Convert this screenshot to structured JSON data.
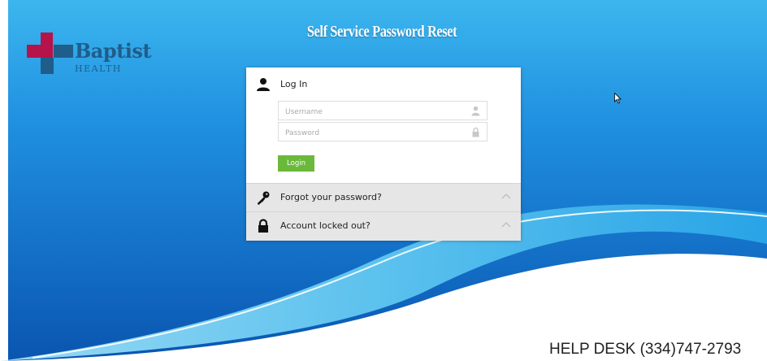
{
  "brand": {
    "name": "Baptist",
    "subname": "HEALTH",
    "logo_colors": {
      "red": "#b5134a",
      "blue": "#1f5d8a"
    }
  },
  "page": {
    "title": "Self Service Password Reset",
    "background_colors": {
      "top": "#1fa3e0",
      "bottom": "#0b5fb8",
      "swoosh": "#7fd3f5"
    }
  },
  "login": {
    "heading": "Log In",
    "heading_icon": "user-icon",
    "username": {
      "value": "",
      "placeholder": "Username",
      "icon": "user-icon"
    },
    "password": {
      "value": "",
      "placeholder": "Password",
      "icon": "lock-icon"
    },
    "button_label": "Login",
    "button_color": "#6ab93b"
  },
  "accordion": [
    {
      "label": "Forgot your password?",
      "icon": "key-icon",
      "state": "collapsed"
    },
    {
      "label": "Account locked out?",
      "icon": "lock-icon",
      "state": "collapsed"
    }
  ],
  "footer": {
    "helpdesk": "HELP DESK (334)747-2793"
  }
}
